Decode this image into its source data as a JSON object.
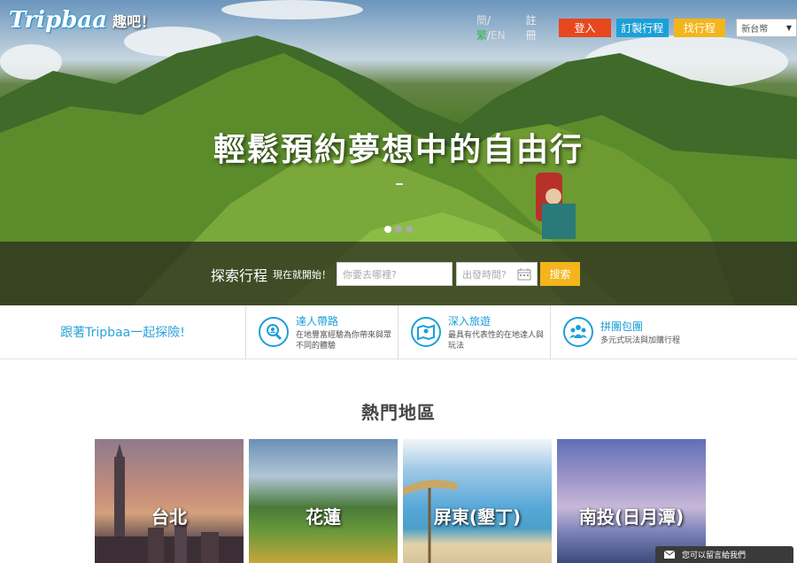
{
  "brand": {
    "logo_text": "Tripbaa",
    "logo_sub": "趣吧！"
  },
  "nav": {
    "lang_simplified": "簡",
    "lang_sep1": "/",
    "lang_traditional": "繁",
    "lang_sep2": "/",
    "lang_english": "EN",
    "register": "註冊",
    "login": "登入",
    "custom_trip": "訂製行程",
    "find_trip": "找行程",
    "currency": "新台幣"
  },
  "hero": {
    "headline": "輕鬆預約夢想中的自由行",
    "slides": 3,
    "active_slide": 1
  },
  "search": {
    "title": "探索行程",
    "subtitle": "現在就開始！",
    "where_placeholder": "你要去哪裡?",
    "date_placeholder": "出發時間?",
    "button": "搜索"
  },
  "features": {
    "tagline": "跟著Tripbaa一起探險!",
    "items": [
      {
        "title": "達人帶路",
        "desc": "在地豐富經驗為你帶來與眾不同的體驗"
      },
      {
        "title": "深入旅遊",
        "desc": "最具有代表性的在地達人與玩法"
      },
      {
        "title": "拼團包團",
        "desc": "多元式玩法與加購行程"
      }
    ]
  },
  "hot_areas": {
    "title": "熱門地區",
    "cards": [
      {
        "label": "台北"
      },
      {
        "label": "花蓮"
      },
      {
        "label": "屏東(墾丁)"
      },
      {
        "label": "南投(日月潭)"
      }
    ]
  },
  "chat": {
    "label": "您可以留言給我們"
  },
  "colors": {
    "accent_blue": "#1aa0d8",
    "login_red": "#e8471e",
    "yellow": "#f3b51b"
  }
}
